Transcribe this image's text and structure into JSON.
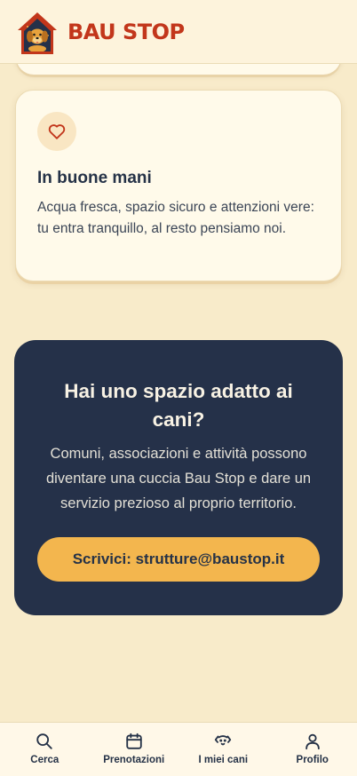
{
  "header": {
    "brand": "BAU STOP",
    "logo_icon": "dog-house-logo-icon"
  },
  "feature_card": {
    "icon": "heart-icon",
    "title": "In buone mani",
    "text": "Acqua fresca, spazio sicuro e attenzioni vere: tu entra tranquillo, al resto pensiamo noi."
  },
  "cta": {
    "title": "Hai uno spazio adatto ai cani?",
    "text": "Comuni, associazioni e attività possono diventare una cuccia Bau Stop e dare un servizio prezioso al proprio territorio.",
    "button_label": "Scrivici: strutture@baustop.it"
  },
  "bottom_nav": {
    "items": [
      {
        "label": "Cerca",
        "icon": "search-icon"
      },
      {
        "label": "Prenotazioni",
        "icon": "calendar-icon"
      },
      {
        "label": "I miei cani",
        "icon": "dog-face-icon"
      },
      {
        "label": "Profilo",
        "icon": "user-icon"
      }
    ]
  },
  "colors": {
    "background": "#f8ebca",
    "brand": "#c2361b",
    "navy": "#253149",
    "accent": "#f3b64e",
    "heart": "#c2361b"
  }
}
